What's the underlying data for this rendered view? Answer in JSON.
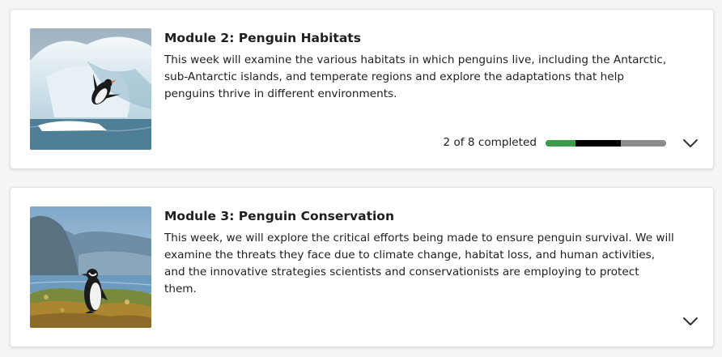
{
  "modules": [
    {
      "title": "Module 2: Penguin Habitats",
      "description": "This week will examine the various habitats in which penguins live, including the Antarctic, sub-Antarctic islands, and temperate regions and explore the adaptations that help penguins thrive in different environments.",
      "progress_label": "2 of 8 completed",
      "progress": {
        "completed": 2,
        "in_progress": 3,
        "total": 8
      },
      "image": "penguin-diving-off-ice"
    },
    {
      "title": "Module 3: Penguin Conservation",
      "description": "This week, we will explore the critical efforts being made to ensure penguin survival. We will examine the threats they face due to climate change, habitat loss, and human activities, and the innovative strategies scientists and conservationists are employing to protect them.",
      "image": "penguin-on-coast"
    }
  ],
  "icons": {
    "expand": "chevron-down-icon"
  },
  "colors": {
    "completed": "#3d9c47",
    "in_progress": "#000000",
    "remaining": "#8c8c8c"
  }
}
